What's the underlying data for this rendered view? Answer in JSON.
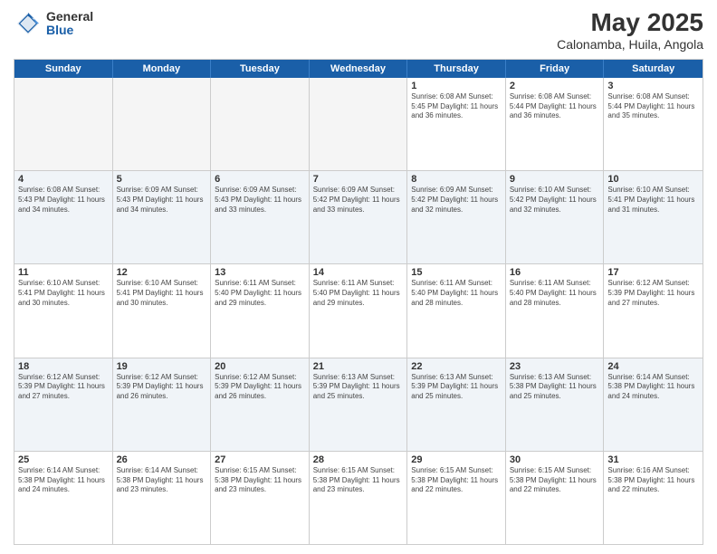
{
  "header": {
    "logo_general": "General",
    "logo_blue": "Blue",
    "title": "May 2025",
    "subtitle": "Calonamba, Huila, Angola"
  },
  "calendar": {
    "days": [
      "Sunday",
      "Monday",
      "Tuesday",
      "Wednesday",
      "Thursday",
      "Friday",
      "Saturday"
    ],
    "rows": [
      [
        {
          "day": "",
          "info": "",
          "empty": true
        },
        {
          "day": "",
          "info": "",
          "empty": true
        },
        {
          "day": "",
          "info": "",
          "empty": true
        },
        {
          "day": "",
          "info": "",
          "empty": true
        },
        {
          "day": "1",
          "info": "Sunrise: 6:08 AM\nSunset: 5:45 PM\nDaylight: 11 hours\nand 36 minutes.",
          "empty": false
        },
        {
          "day": "2",
          "info": "Sunrise: 6:08 AM\nSunset: 5:44 PM\nDaylight: 11 hours\nand 36 minutes.",
          "empty": false
        },
        {
          "day": "3",
          "info": "Sunrise: 6:08 AM\nSunset: 5:44 PM\nDaylight: 11 hours\nand 35 minutes.",
          "empty": false
        }
      ],
      [
        {
          "day": "4",
          "info": "Sunrise: 6:08 AM\nSunset: 5:43 PM\nDaylight: 11 hours\nand 34 minutes.",
          "empty": false
        },
        {
          "day": "5",
          "info": "Sunrise: 6:09 AM\nSunset: 5:43 PM\nDaylight: 11 hours\nand 34 minutes.",
          "empty": false
        },
        {
          "day": "6",
          "info": "Sunrise: 6:09 AM\nSunset: 5:43 PM\nDaylight: 11 hours\nand 33 minutes.",
          "empty": false
        },
        {
          "day": "7",
          "info": "Sunrise: 6:09 AM\nSunset: 5:42 PM\nDaylight: 11 hours\nand 33 minutes.",
          "empty": false
        },
        {
          "day": "8",
          "info": "Sunrise: 6:09 AM\nSunset: 5:42 PM\nDaylight: 11 hours\nand 32 minutes.",
          "empty": false
        },
        {
          "day": "9",
          "info": "Sunrise: 6:10 AM\nSunset: 5:42 PM\nDaylight: 11 hours\nand 32 minutes.",
          "empty": false
        },
        {
          "day": "10",
          "info": "Sunrise: 6:10 AM\nSunset: 5:41 PM\nDaylight: 11 hours\nand 31 minutes.",
          "empty": false
        }
      ],
      [
        {
          "day": "11",
          "info": "Sunrise: 6:10 AM\nSunset: 5:41 PM\nDaylight: 11 hours\nand 30 minutes.",
          "empty": false
        },
        {
          "day": "12",
          "info": "Sunrise: 6:10 AM\nSunset: 5:41 PM\nDaylight: 11 hours\nand 30 minutes.",
          "empty": false
        },
        {
          "day": "13",
          "info": "Sunrise: 6:11 AM\nSunset: 5:40 PM\nDaylight: 11 hours\nand 29 minutes.",
          "empty": false
        },
        {
          "day": "14",
          "info": "Sunrise: 6:11 AM\nSunset: 5:40 PM\nDaylight: 11 hours\nand 29 minutes.",
          "empty": false
        },
        {
          "day": "15",
          "info": "Sunrise: 6:11 AM\nSunset: 5:40 PM\nDaylight: 11 hours\nand 28 minutes.",
          "empty": false
        },
        {
          "day": "16",
          "info": "Sunrise: 6:11 AM\nSunset: 5:40 PM\nDaylight: 11 hours\nand 28 minutes.",
          "empty": false
        },
        {
          "day": "17",
          "info": "Sunrise: 6:12 AM\nSunset: 5:39 PM\nDaylight: 11 hours\nand 27 minutes.",
          "empty": false
        }
      ],
      [
        {
          "day": "18",
          "info": "Sunrise: 6:12 AM\nSunset: 5:39 PM\nDaylight: 11 hours\nand 27 minutes.",
          "empty": false
        },
        {
          "day": "19",
          "info": "Sunrise: 6:12 AM\nSunset: 5:39 PM\nDaylight: 11 hours\nand 26 minutes.",
          "empty": false
        },
        {
          "day": "20",
          "info": "Sunrise: 6:12 AM\nSunset: 5:39 PM\nDaylight: 11 hours\nand 26 minutes.",
          "empty": false
        },
        {
          "day": "21",
          "info": "Sunrise: 6:13 AM\nSunset: 5:39 PM\nDaylight: 11 hours\nand 25 minutes.",
          "empty": false
        },
        {
          "day": "22",
          "info": "Sunrise: 6:13 AM\nSunset: 5:39 PM\nDaylight: 11 hours\nand 25 minutes.",
          "empty": false
        },
        {
          "day": "23",
          "info": "Sunrise: 6:13 AM\nSunset: 5:38 PM\nDaylight: 11 hours\nand 25 minutes.",
          "empty": false
        },
        {
          "day": "24",
          "info": "Sunrise: 6:14 AM\nSunset: 5:38 PM\nDaylight: 11 hours\nand 24 minutes.",
          "empty": false
        }
      ],
      [
        {
          "day": "25",
          "info": "Sunrise: 6:14 AM\nSunset: 5:38 PM\nDaylight: 11 hours\nand 24 minutes.",
          "empty": false
        },
        {
          "day": "26",
          "info": "Sunrise: 6:14 AM\nSunset: 5:38 PM\nDaylight: 11 hours\nand 23 minutes.",
          "empty": false
        },
        {
          "day": "27",
          "info": "Sunrise: 6:15 AM\nSunset: 5:38 PM\nDaylight: 11 hours\nand 23 minutes.",
          "empty": false
        },
        {
          "day": "28",
          "info": "Sunrise: 6:15 AM\nSunset: 5:38 PM\nDaylight: 11 hours\nand 23 minutes.",
          "empty": false
        },
        {
          "day": "29",
          "info": "Sunrise: 6:15 AM\nSunset: 5:38 PM\nDaylight: 11 hours\nand 22 minutes.",
          "empty": false
        },
        {
          "day": "30",
          "info": "Sunrise: 6:15 AM\nSunset: 5:38 PM\nDaylight: 11 hours\nand 22 minutes.",
          "empty": false
        },
        {
          "day": "31",
          "info": "Sunrise: 6:16 AM\nSunset: 5:38 PM\nDaylight: 11 hours\nand 22 minutes.",
          "empty": false
        }
      ]
    ]
  }
}
